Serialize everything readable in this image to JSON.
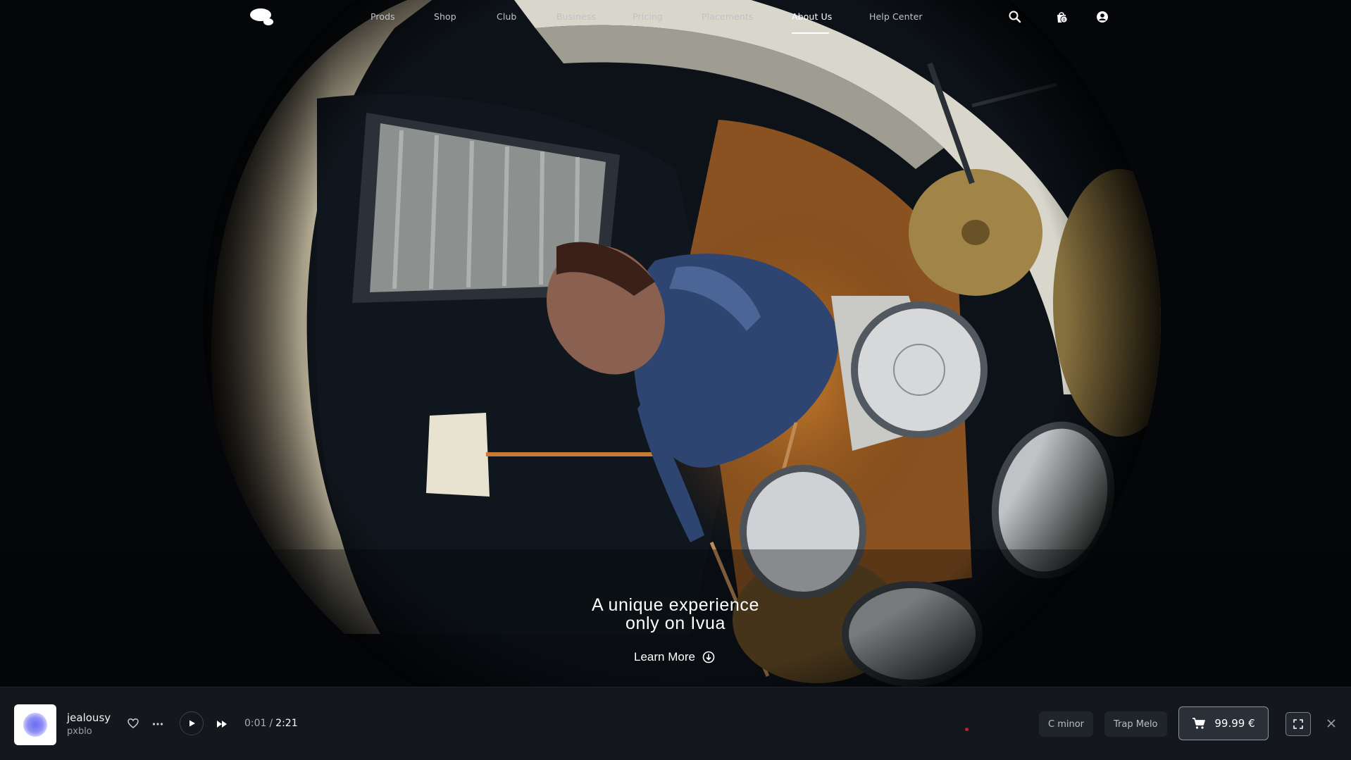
{
  "nav": {
    "links": [
      {
        "label": "Prods"
      },
      {
        "label": "Shop"
      },
      {
        "label": "Club"
      },
      {
        "label": "Business"
      },
      {
        "label": "Pricing"
      },
      {
        "label": "Placements"
      },
      {
        "label": "About Us"
      },
      {
        "label": "Help Center"
      }
    ],
    "active": "About Us",
    "cart_count": "0",
    "icons": [
      "search-icon",
      "cart-bag-icon",
      "user-account-icon"
    ]
  },
  "hero": {
    "title_line1": "A unique experience",
    "title_line2": "only on Ivua",
    "cta_label": "Learn More",
    "cta_icon": "arrow-down-circle-icon"
  },
  "player": {
    "track_title": "jealousy",
    "artist": "pxblo",
    "current_time": "0:01",
    "separator": "/",
    "total_time": "2:21",
    "key_tag": "C minor",
    "genre_tag": "Trap Melo",
    "price": "99.99 €",
    "icons": [
      "heart-icon",
      "more-icon",
      "play-icon",
      "skip-forward-icon",
      "cart-icon",
      "expand-icon",
      "close-icon"
    ]
  },
  "colors": {
    "background": "#05070a",
    "player_bg": "#14181d",
    "text_primary": "#ffffff",
    "text_muted": "#bfc3c8",
    "accent_cover": "#6b6cf0"
  }
}
